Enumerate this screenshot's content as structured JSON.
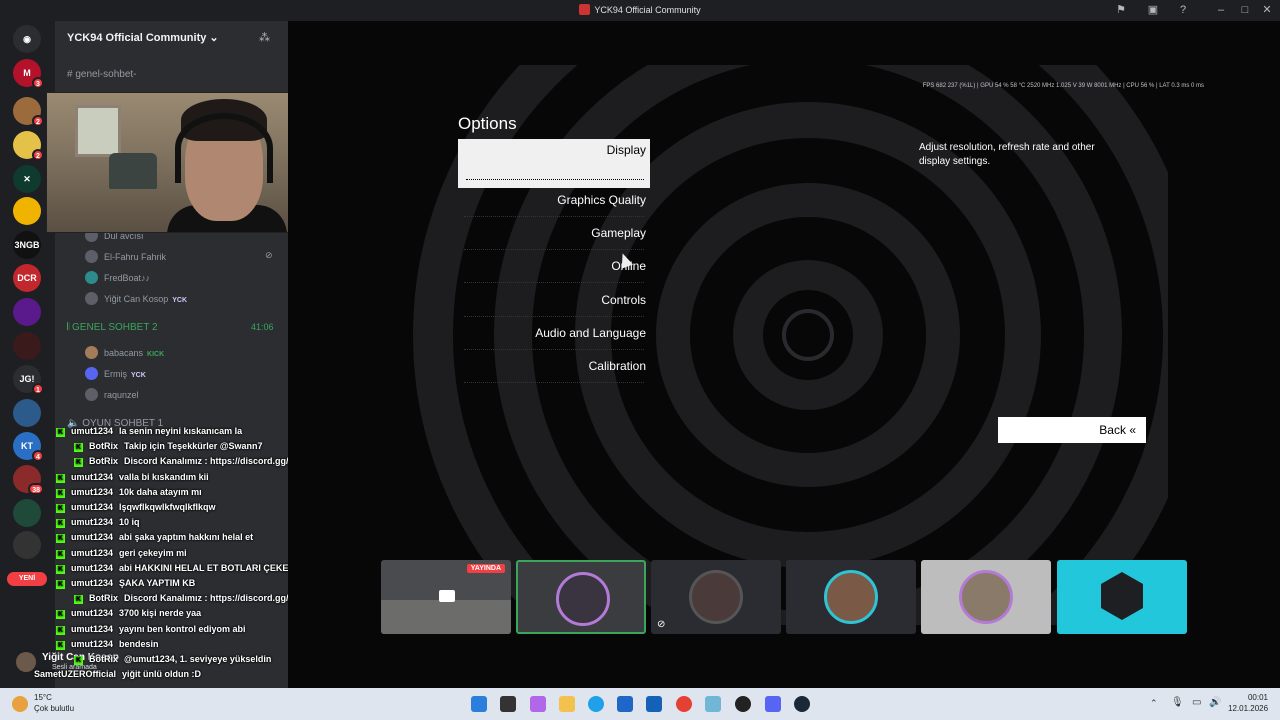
{
  "window": {
    "title": "YCK94 Official Community"
  },
  "colors": {
    "discord_bg": "#2b2d31",
    "rail_bg": "#1e1f22",
    "kick_green": "#53fc18",
    "live_red": "#f23f43",
    "voice_green": "#3ba55c"
  },
  "rail": {
    "badges": [
      "3",
      "2",
      "2",
      "1",
      "4",
      "38"
    ],
    "labels": [
      "3NGB",
      "DCR",
      "JG!",
      "KT"
    ],
    "yeni": "YENİ"
  },
  "sidebar": {
    "server_name": "YCK94 Official Community",
    "text_channel": "genel-sohbet-",
    "voice_users_1": [
      {
        "name": "Dul avcısı"
      },
      {
        "name": "El-Fahru Fahrik"
      },
      {
        "name": "FredBoat♪♪"
      },
      {
        "name": "Yiğit Can Kosop",
        "tag": "YCK"
      }
    ],
    "voice_channel_2": {
      "name": "GENEL SOHBET 2",
      "time": "41:06"
    },
    "voice_users_2": [
      {
        "name": "babacans",
        "tag": "KICK"
      },
      {
        "name": "Ermiş",
        "tag": "YCK"
      },
      {
        "name": "raqunzel"
      }
    ],
    "voice_channel_3": "OYUN SOHBET 1",
    "user_panel": {
      "status": "Sesli aramada",
      "name": "Yiğit Can Kosop"
    }
  },
  "chat": [
    {
      "user": "umut1234",
      "msg": "la senin neyini kıskanıcam la"
    },
    {
      "user": "BotRix",
      "msg": "Takip için Teşekkürler @Swann7"
    },
    {
      "user": "BotRix",
      "msg": "Discord Kanalımız : https://discord.gg/xeB9JejQHk"
    },
    {
      "user": "umut1234",
      "msg": "valla bi kıskandım kii"
    },
    {
      "user": "umut1234",
      "msg": "10k daha atayım mı"
    },
    {
      "user": "umut1234",
      "msg": "lşqwflkqwlkfwqlkflkqw"
    },
    {
      "user": "umut1234",
      "msg": "10 iq"
    },
    {
      "user": "umut1234",
      "msg": "abi şaka yaptım hakkını helal et"
    },
    {
      "user": "umut1234",
      "msg": "geri çekeyim mi"
    },
    {
      "user": "umut1234",
      "msg": "abi HAKKINI HELAL ET BOTLARI ÇEKEYİM YA"
    },
    {
      "user": "umut1234",
      "msg": "ŞAKA YAPTIM KB"
    },
    {
      "user": "BotRix",
      "msg": "Discord Kanalımız : https://discord.gg/xeB9JejQHk"
    },
    {
      "user": "umut1234",
      "msg": "3700 kişi nerde yaa"
    },
    {
      "user": "umut1234",
      "msg": "yayını ben kontrol ediyom abi"
    },
    {
      "user": "umut1234",
      "msg": "bendesin"
    },
    {
      "user": "BotRix",
      "msg": "@umut1234, 1. seviyeye yükseldin"
    },
    {
      "user": "SametUZEROfficial",
      "msg": "yiğit ünlü oldun :D"
    }
  ],
  "game": {
    "stats": "FPS 682  237 (%1L)  |  GPU 54 %  58 °C  2520 MHz  1.025 V  39 W  8001 MHz  |  CPU 56 %  |  LAT 0.3 ms  0 ms",
    "options_title": "Options",
    "menu": [
      "Display",
      "Graphics Quality",
      "Gameplay",
      "Online",
      "Controls",
      "Audio and Language",
      "Calibration"
    ],
    "selected_index": 0,
    "description": "Adjust resolution, refresh rate and other display settings.",
    "back": "Back"
  },
  "stream_tiles": [
    {
      "live_label": "YAYINDA"
    },
    {},
    {},
    {},
    {},
    {}
  ],
  "taskbar": {
    "weather_temp": "15°C",
    "weather_desc": "Çok bulutlu",
    "time": "00:01",
    "date": "12.01.2026"
  }
}
